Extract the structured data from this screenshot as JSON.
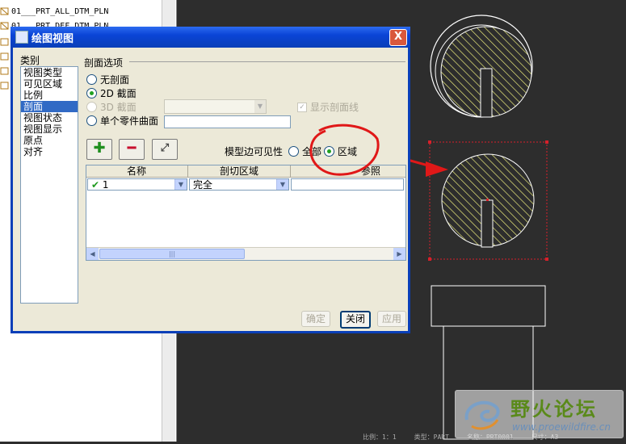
{
  "tree": {
    "items": [
      "01___PRT_ALL_DTM_PLN",
      "01___PRT_DEF_DTM_PLN"
    ]
  },
  "dialog": {
    "title": "绘图视图",
    "close": "X",
    "category_label": "类别",
    "categories": [
      "视图类型",
      "可见区域",
      "比例",
      "剖面",
      "视图状态",
      "视图显示",
      "原点",
      "对齐"
    ],
    "selected_category": "剖面",
    "section_options_label": "剖面选项",
    "radio_no_section": "无剖面",
    "radio_2d": "2D 截面",
    "radio_3d": "3D 截面",
    "radio_single_surface": "单个零件曲面",
    "selected_option": "2D 截面",
    "show_section_line": "显示剖面线",
    "visibility_label": "模型边可见性",
    "visibility_all": "全部",
    "visibility_area": "区域",
    "visibility_selected": "区域",
    "table_headers": [
      "名称",
      "剖切区域",
      "参照"
    ],
    "row": {
      "name": "1",
      "region": "完全"
    },
    "buttons": {
      "ok": "确定",
      "close": "关闭",
      "apply": "应用"
    }
  },
  "statusbar": [
    "比例：1：1",
    "类型：PART",
    "名称：PRT0001",
    "尺寸：A3"
  ],
  "watermark": {
    "title": "野火论坛",
    "url": "www.proewildfire.cn"
  },
  "colors": {
    "canvas_bg": "#2d2d2d",
    "hatch": "#e8e87a",
    "selection_box": "#d8202a",
    "annotation_red": "#e01818",
    "title_blue": "#0a44d6"
  }
}
